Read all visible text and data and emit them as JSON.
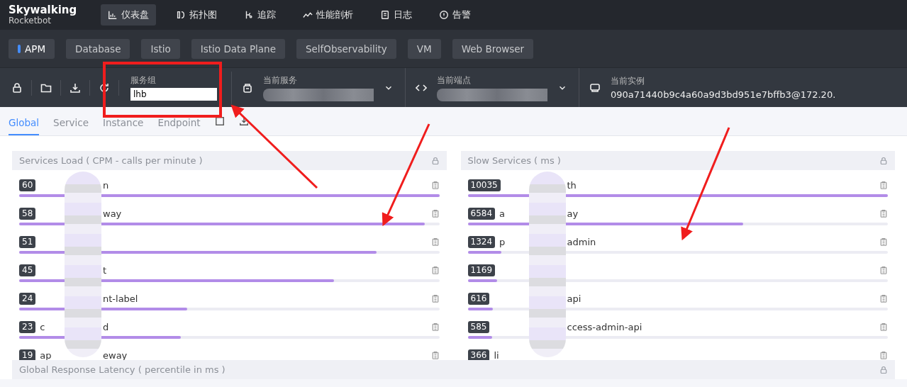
{
  "logo": {
    "title": "Skywalking",
    "subtitle": "Rocketbot"
  },
  "nav": [
    {
      "label": "仪表盘",
      "selected": true
    },
    {
      "label": "拓扑图",
      "selected": false
    },
    {
      "label": "追踪",
      "selected": false
    },
    {
      "label": "性能剖析",
      "selected": false
    },
    {
      "label": "日志",
      "selected": false
    },
    {
      "label": "告警",
      "selected": false
    }
  ],
  "layers": [
    {
      "label": "APM",
      "selected": true
    },
    {
      "label": "Database",
      "selected": false
    },
    {
      "label": "Istio",
      "selected": false
    },
    {
      "label": "Istio Data Plane",
      "selected": false
    },
    {
      "label": "SelfObservability",
      "selected": false
    },
    {
      "label": "VM",
      "selected": false
    },
    {
      "label": "Web Browser",
      "selected": false
    }
  ],
  "selector_bar": {
    "group": {
      "label": "服务组",
      "value": "lhb"
    },
    "service": {
      "label": "当前服务"
    },
    "endpoint": {
      "label": "当前端点"
    },
    "instance": {
      "label": "当前实例",
      "value": "090a71440b9c4a60a9d3bd951e7bffb3@172.20."
    }
  },
  "tabs": [
    {
      "label": "Global",
      "selected": true
    },
    {
      "label": "Service",
      "selected": false
    },
    {
      "label": "Instance",
      "selected": false
    },
    {
      "label": "Endpoint",
      "selected": false
    }
  ],
  "panels": [
    {
      "title": "Services Load ( CPM - calls per minute )",
      "rows": [
        {
          "value": "60",
          "name_end": "n",
          "level": 1.0
        },
        {
          "value": "58",
          "name_end": "way",
          "level": 0.965
        },
        {
          "value": "51",
          "level": 0.85
        },
        {
          "value": "45",
          "name_end": "t",
          "level": 0.75
        },
        {
          "value": "24",
          "name_end": "nt-label",
          "level": 0.4
        },
        {
          "value": "23",
          "name_start": "c",
          "name_end": "d",
          "level": 0.385
        },
        {
          "value": "19",
          "name_start": "ap",
          "name_end": "eway"
        }
      ]
    },
    {
      "title": "Slow Services ( ms )",
      "rows": [
        {
          "value": "10035",
          "name_end": "th",
          "level": 1.0
        },
        {
          "value": "6584",
          "name_start": "a",
          "name_end": "ay",
          "level": 0.656
        },
        {
          "value": "1324",
          "name_start": "p",
          "name_end": "admin",
          "level": 0.08
        },
        {
          "value": "1169",
          "level": 0.07
        },
        {
          "value": "616",
          "name_end": "api",
          "level": 0.06
        },
        {
          "value": "585",
          "name_end": "ccess-admin-api",
          "level": 0.058
        },
        {
          "value": "366",
          "name_start": "li"
        }
      ]
    }
  ],
  "bottom_panel": {
    "title": "Global Response Latency ( percentile in ms )"
  }
}
